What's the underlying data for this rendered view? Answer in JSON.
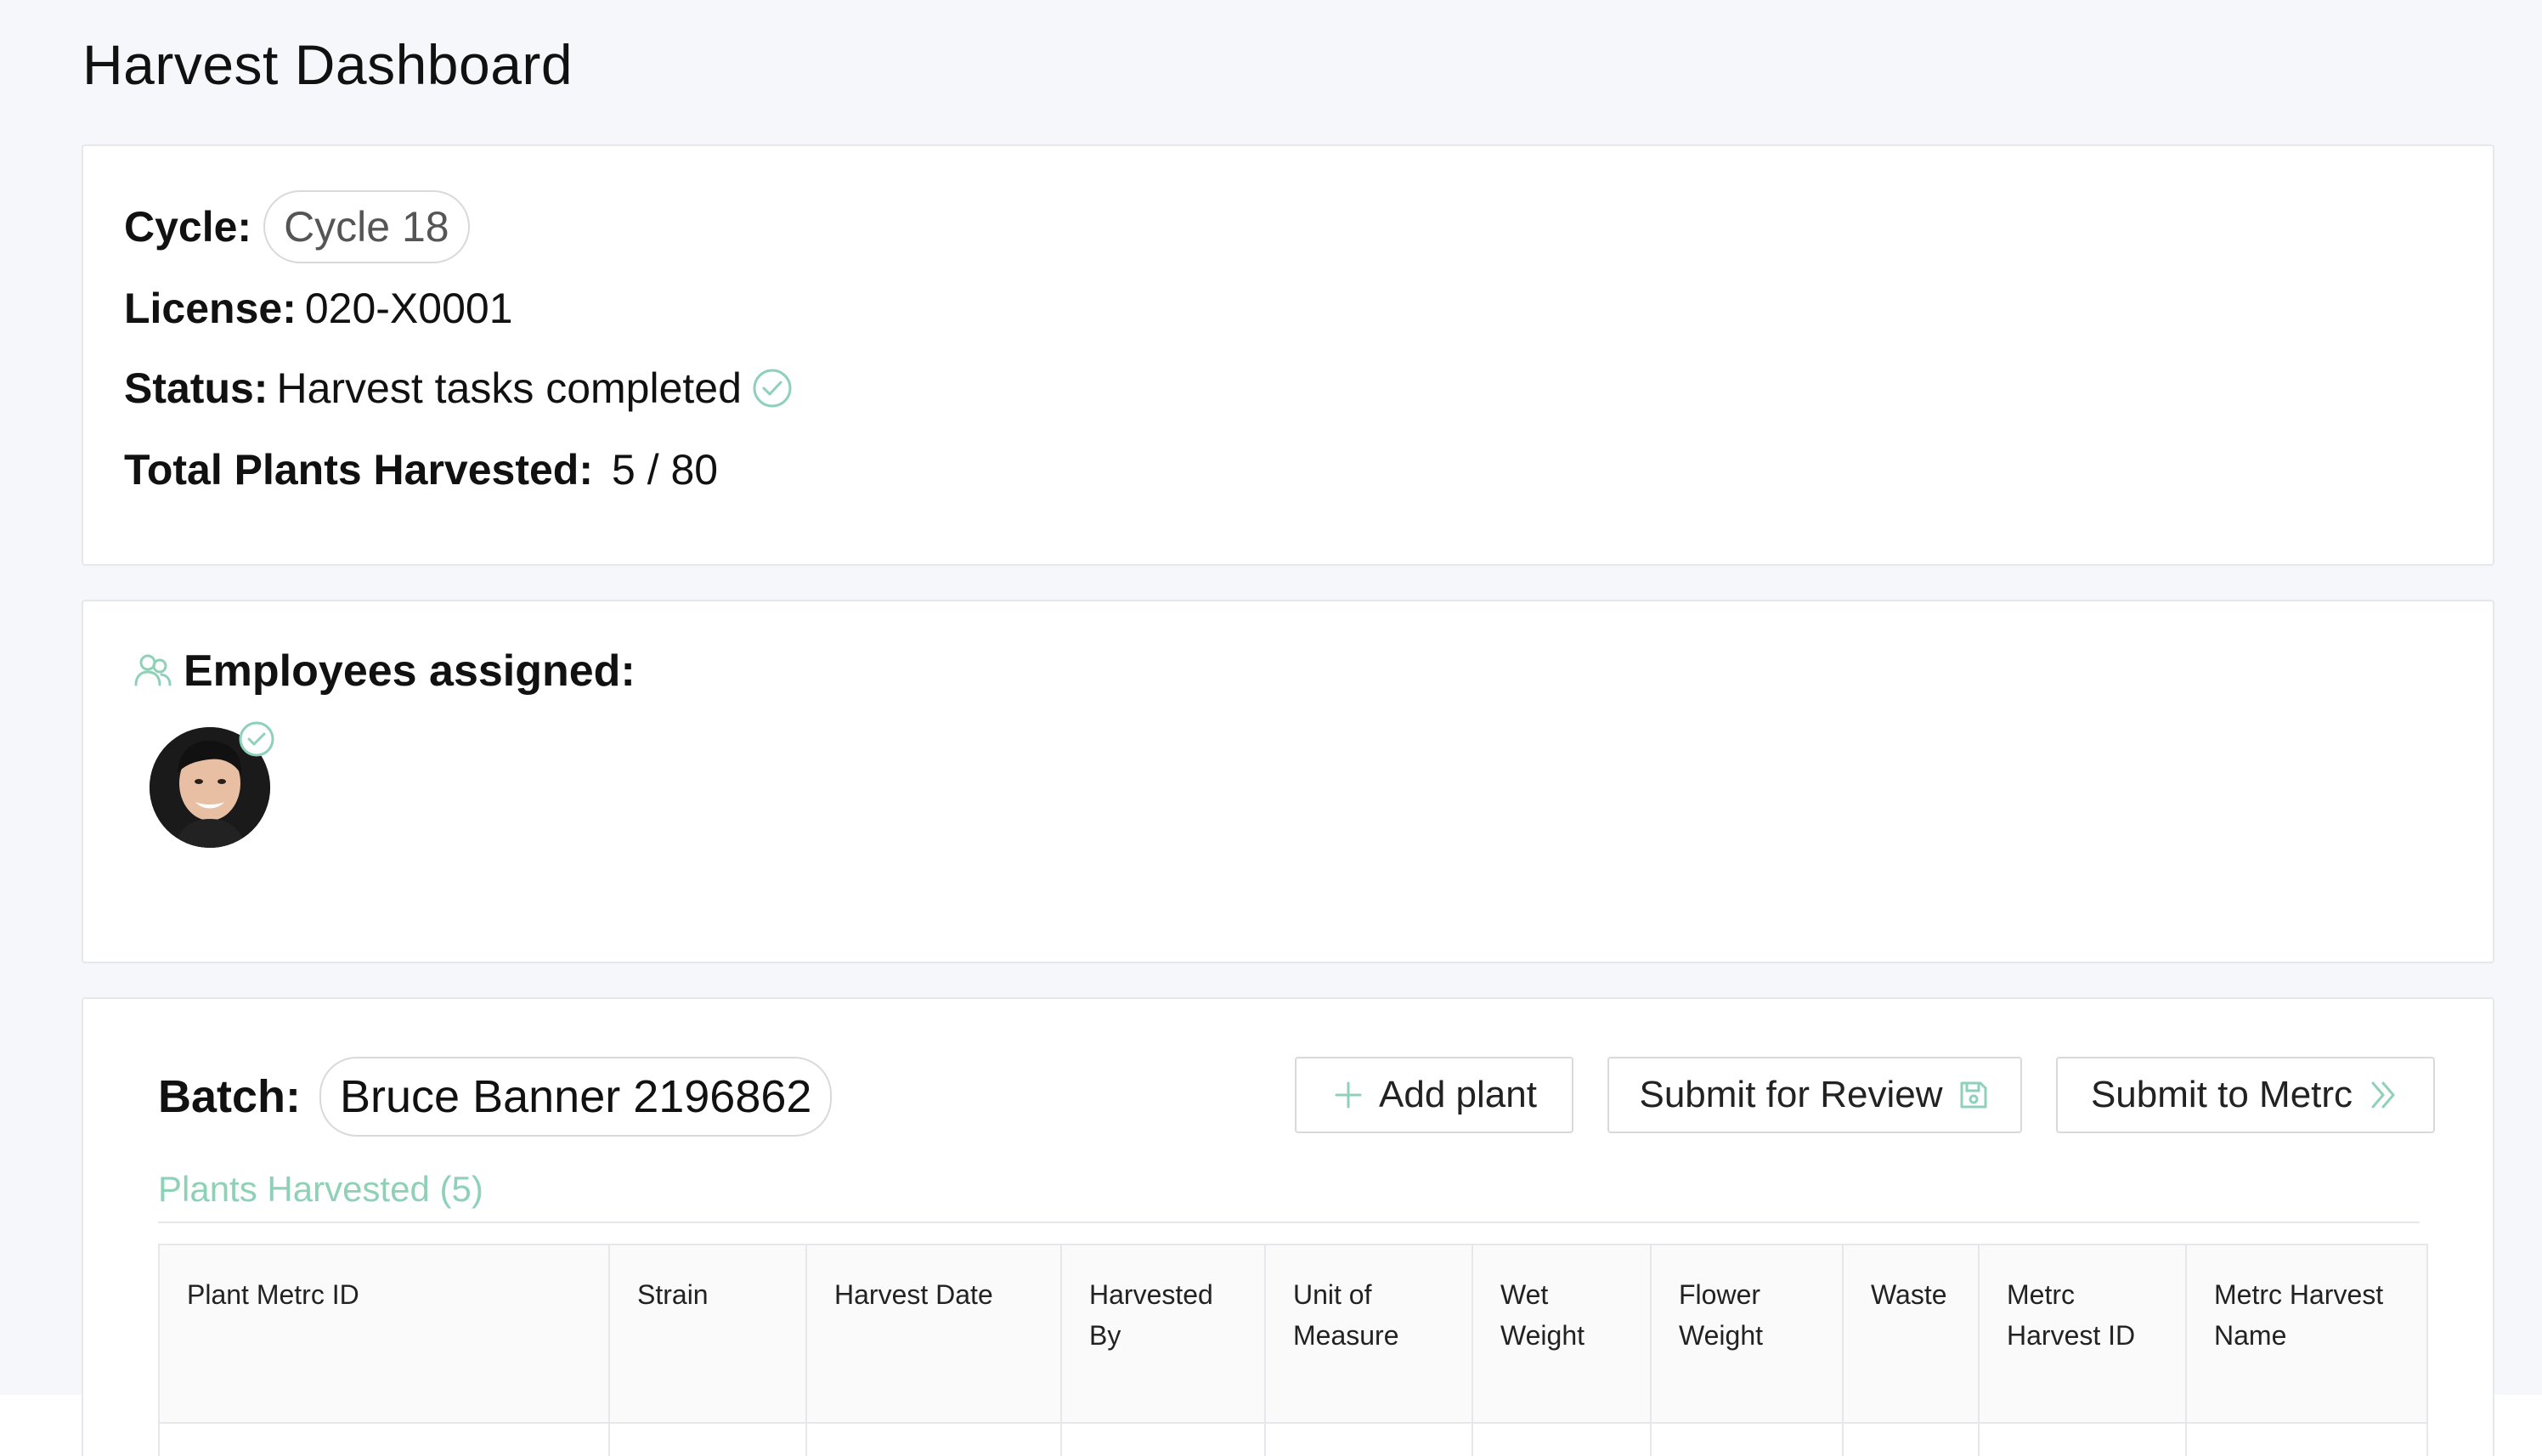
{
  "header": {
    "title": "Harvest Dashboard"
  },
  "info": {
    "cycle_label": "Cycle:",
    "cycle_value": "Cycle 18",
    "license_label": "License:",
    "license_value": "020-X0001",
    "status_label": "Status:",
    "status_value": "Harvest tasks completed",
    "total_label": "Total Plants Harvested:",
    "total_value": "5 / 80"
  },
  "employees": {
    "title": "Employees assigned:"
  },
  "batch": {
    "label": "Batch:",
    "value": "Bruce Banner 2196862",
    "buttons": {
      "add_plant": "Add plant",
      "submit_review": "Submit for Review",
      "submit_metrc": "Submit to Metrc"
    },
    "tab_label": "Plants Harvested (5)",
    "columns": [
      "Plant Metrc ID",
      "Strain",
      "Harvest Date",
      "Harvested By",
      "Unit of Measure",
      "Wet Weight",
      "Flower Weight",
      "Waste",
      "Metrc Harvest ID",
      "Metrc Harvest Name"
    ]
  },
  "colors": {
    "accent": "#8fd1b8",
    "background": "#f6f7fb",
    "border": "#e5e7eb"
  },
  "icons": {
    "status": "check-circle-icon",
    "employees": "users-icon",
    "add": "plus-icon",
    "review": "save-icon",
    "metrc": "double-chevron-right-icon"
  }
}
